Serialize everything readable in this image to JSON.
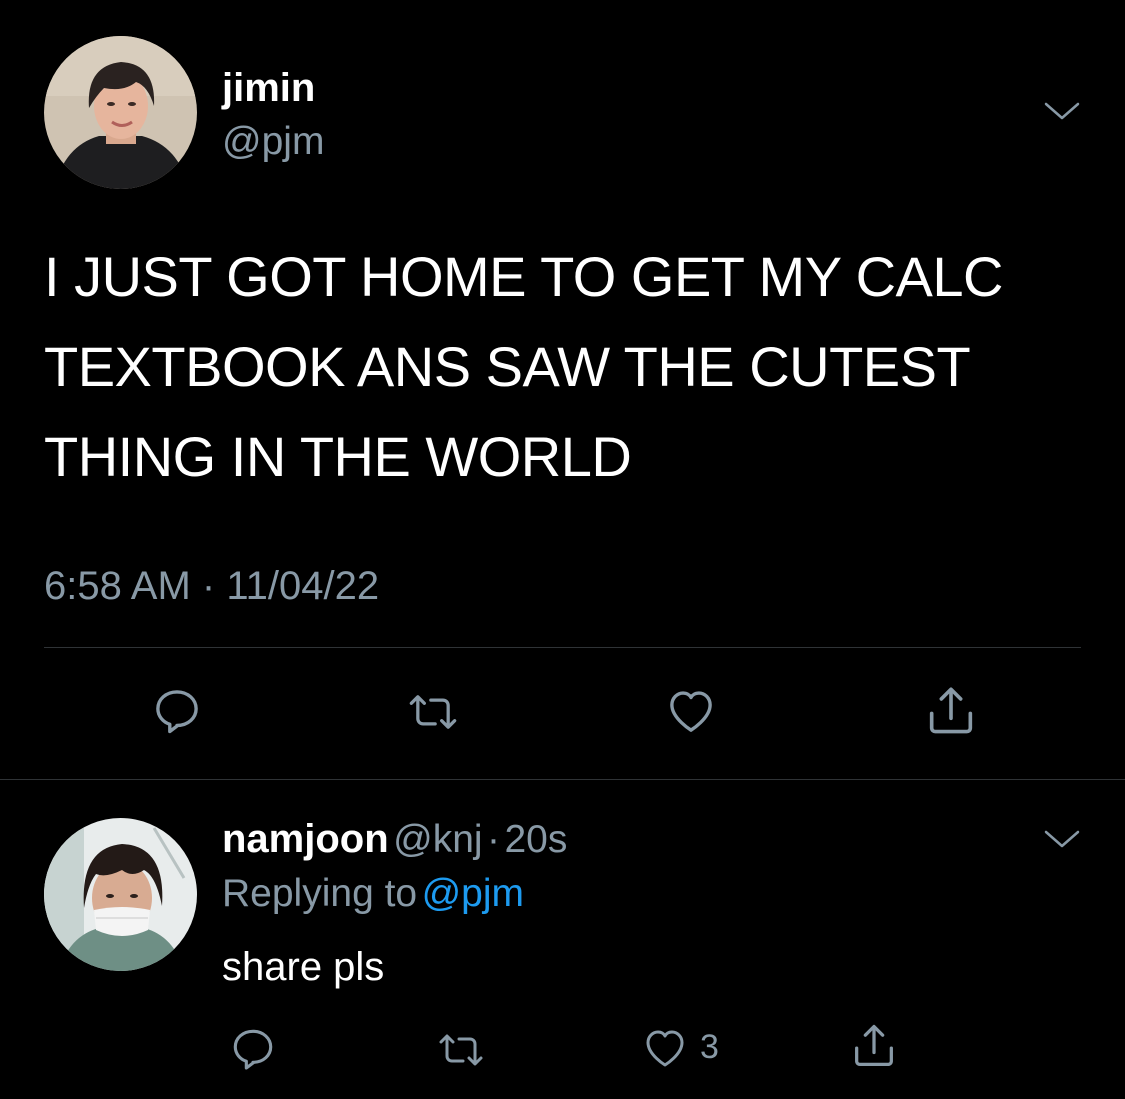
{
  "tweet": {
    "author": {
      "display_name": "jimin",
      "handle": "@pjm",
      "avatar_icon": "profile-photo"
    },
    "text_lines": [
      "I JUST GOT HOME TO GET MY CALC",
      "TEXTBOOK ANS SAW THE CUTEST",
      "THING IN THE WORLD"
    ],
    "time": "6:58 AM",
    "separator": "·",
    "date": "11/04/22",
    "actions": [
      "reply-icon",
      "retweet-icon",
      "like-icon",
      "share-icon"
    ]
  },
  "reply": {
    "author": {
      "display_name": "namjoon",
      "handle": "@knj",
      "avatar_icon": "profile-photo"
    },
    "separator": "·",
    "age": "20s",
    "replying_prefix": "Replying to",
    "replying_to": "@pjm",
    "text": "share pls",
    "like_count": "3",
    "actions": [
      "reply-icon",
      "retweet-icon",
      "like-icon",
      "share-icon"
    ]
  },
  "colors": {
    "background": "#000000",
    "text": "#ffffff",
    "secondary": "#8899a6",
    "accent": "#1d9bf0",
    "divider": "#2f3336"
  }
}
